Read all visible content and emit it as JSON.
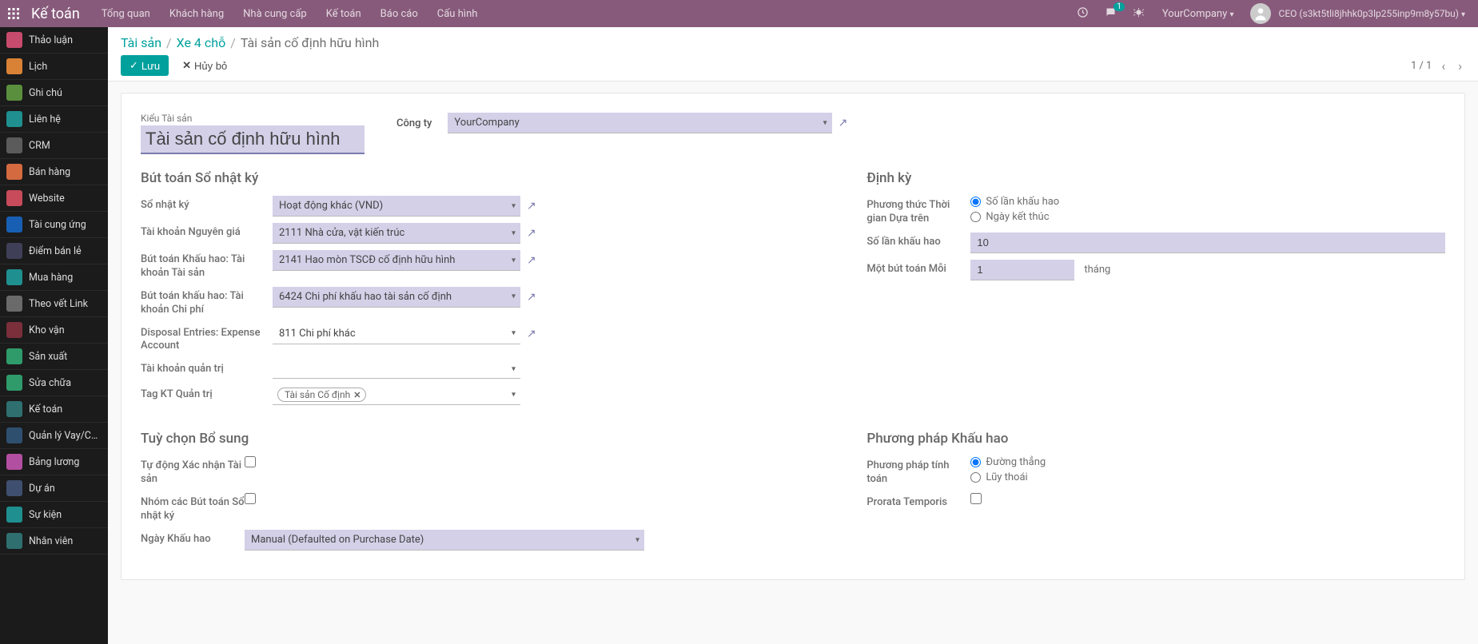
{
  "navbar": {
    "app_title": "Kế toán",
    "menu": [
      "Tổng quan",
      "Khách hàng",
      "Nhà cung cấp",
      "Kế toán",
      "Báo cáo",
      "Cấu hình"
    ],
    "msg_badge": "1",
    "company": "YourCompany",
    "username": "CEO (s3kt5tli8jhhk0p3lp255inp9m8y57bu)"
  },
  "sidebar": {
    "items": [
      {
        "label": "Thảo luận",
        "color": "#c74b6c"
      },
      {
        "label": "Lịch",
        "color": "#d98236"
      },
      {
        "label": "Ghi chú",
        "color": "#5a8f3e"
      },
      {
        "label": "Liên hệ",
        "color": "#1f8f8f"
      },
      {
        "label": "CRM",
        "color": "#5b5b5b"
      },
      {
        "label": "Bán hàng",
        "color": "#d46a3f"
      },
      {
        "label": "Website",
        "color": "#c74b5a"
      },
      {
        "label": "Tài cung ứng",
        "color": "#185fb3"
      },
      {
        "label": "Điểm bán lẻ",
        "color": "#3f3f58"
      },
      {
        "label": "Mua hàng",
        "color": "#1f8f8f"
      },
      {
        "label": "Theo vết Link",
        "color": "#6a6a6a"
      },
      {
        "label": "Kho vận",
        "color": "#7a2f3a"
      },
      {
        "label": "Sản xuất",
        "color": "#2f9b6a"
      },
      {
        "label": "Sửa chữa",
        "color": "#2f9b6a"
      },
      {
        "label": "Kế toán",
        "color": "#2f6f6f"
      },
      {
        "label": "Quản lý Vay/Ch...",
        "color": "#2f4f6f"
      },
      {
        "label": "Bảng lương",
        "color": "#b34fa0"
      },
      {
        "label": "Dự án",
        "color": "#3f4f6f"
      },
      {
        "label": "Sự kiện",
        "color": "#1f8f8f"
      },
      {
        "label": "Nhân viên",
        "color": "#2f6f6f"
      }
    ]
  },
  "breadcrumb": {
    "l1": "Tài sản",
    "l2": "Xe 4 chỗ",
    "l3": "Tài sản cố định hữu hình"
  },
  "actions": {
    "save": "Lưu",
    "discard": "Hủy bỏ"
  },
  "pager": "1 / 1",
  "form": {
    "name_label": "Kiểu Tài sản",
    "name_value": "Tài sản cố định hữu hình",
    "company_label": "Công ty",
    "company_value": "YourCompany",
    "group_journal_title": "Bút toán Sổ nhật ký",
    "journal_label": "Sổ nhật ký",
    "journal_value": "Hoạt động khác (VND)",
    "origacct_label": "Tài khoản Nguyên giá",
    "origacct_value": "2111 Nhà cửa, vật kiến trúc",
    "depacct_label": "Bút toán Khấu hao: Tài khoản Tài sản",
    "depacct_value": "2141 Hao mòn TSCĐ cố định hữu hình",
    "expacct_label": "Bút toán khấu hao: Tài khoản Chi phí",
    "expacct_value": "6424 Chi phí khấu hao tài sản cố định",
    "dispacct_label": "Disposal Entries: Expense Account",
    "dispacct_value": "811 Chi phí khác",
    "mgmt_label": "Tài khoản quản trị",
    "tag_label": "Tag KT Quản trị",
    "tag_value": "Tài sản Cố định",
    "group_periodic_title": "Định kỳ",
    "timemethod_label": "Phương thức Thời gian Dựa trên",
    "timemethod_opts": {
      "count": "Số lần khấu hao",
      "end": "Ngày kết thúc"
    },
    "count_label": "Số lần khấu hao",
    "count_value": "10",
    "one_label": "Một bút toán Mỗi",
    "one_value": "1",
    "one_unit": "tháng",
    "group_extra_title": "Tuỳ chọn Bổ sung",
    "auto_label": "Tự động Xác nhận Tài sản",
    "group_entries_label": "Nhóm các Bút toán Sổ nhật ký",
    "depdate_label": "Ngày Khấu hao",
    "depdate_value": "Manual (Defaulted on Purchase Date)",
    "group_method_title": "Phương pháp Khấu hao",
    "calc_label": "Phương pháp tính toán",
    "calc_opts": {
      "linear": "Đường thẳng",
      "declining": "Lũy thoái"
    },
    "prorata_label": "Prorata Temporis"
  }
}
